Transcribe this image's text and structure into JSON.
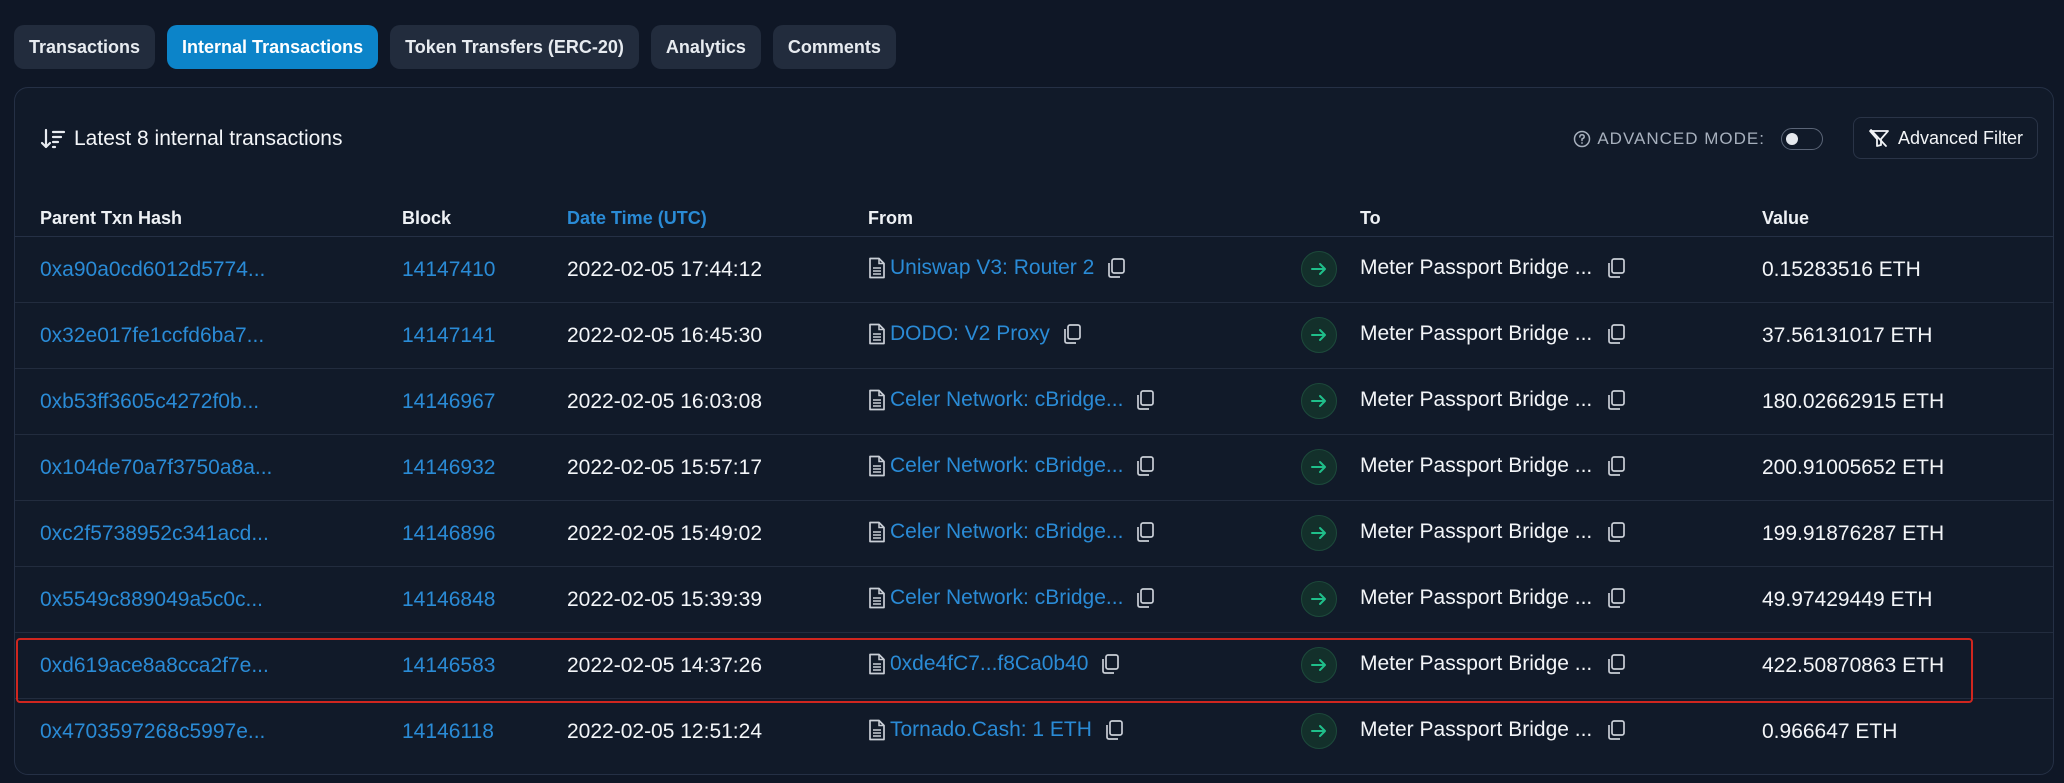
{
  "tabs": [
    {
      "label": "Transactions"
    },
    {
      "label": "Internal Transactions"
    },
    {
      "label": "Token Transfers (ERC-20)"
    },
    {
      "label": "Analytics"
    },
    {
      "label": "Comments"
    }
  ],
  "active_tab": "Internal Transactions",
  "card": {
    "summary": "Latest 8 internal transactions",
    "advanced_mode_label": "ADVANCED MODE:",
    "advanced_mode_on": false,
    "advanced_filter_label": "Advanced Filter"
  },
  "table": {
    "headers": {
      "parent_hash": "Parent Txn Hash",
      "block": "Block",
      "datetime": "Date Time (UTC)",
      "from": "From",
      "to": "To",
      "value": "Value"
    },
    "rows": [
      {
        "hash": "0xa90a0cd6012d5774...",
        "block": "14147410",
        "datetime": "2022-02-05 17:44:12",
        "from": "Uniswap V3: Router 2",
        "to": "Meter Passport Bridge ...",
        "value": "0.15283516 ETH"
      },
      {
        "hash": "0x32e017fe1ccfd6ba7...",
        "block": "14147141",
        "datetime": "2022-02-05 16:45:30",
        "from": "DODO: V2 Proxy",
        "to": "Meter Passport Bridge ...",
        "value": "37.56131017 ETH"
      },
      {
        "hash": "0xb53ff3605c4272f0b...",
        "block": "14146967",
        "datetime": "2022-02-05 16:03:08",
        "from": "Celer Network: cBridge...",
        "to": "Meter Passport Bridge ...",
        "value": "180.02662915 ETH"
      },
      {
        "hash": "0x104de70a7f3750a8a...",
        "block": "14146932",
        "datetime": "2022-02-05 15:57:17",
        "from": "Celer Network: cBridge...",
        "to": "Meter Passport Bridge ...",
        "value": "200.91005652 ETH"
      },
      {
        "hash": "0xc2f5738952c341acd...",
        "block": "14146896",
        "datetime": "2022-02-05 15:49:02",
        "from": "Celer Network: cBridge...",
        "to": "Meter Passport Bridge ...",
        "value": "199.91876287 ETH"
      },
      {
        "hash": "0x5549c889049a5c0c...",
        "block": "14146848",
        "datetime": "2022-02-05 15:39:39",
        "from": "Celer Network: cBridge...",
        "to": "Meter Passport Bridge ...",
        "value": "49.97429449 ETH"
      },
      {
        "hash": "0xd619ace8a8cca2f7e...",
        "block": "14146583",
        "datetime": "2022-02-05 14:37:26",
        "from": "0xde4fC7...f8Ca0b40",
        "to": "Meter Passport Bridge ...",
        "value": "422.50870863 ETH"
      },
      {
        "hash": "0x4703597268c5997e...",
        "block": "14146118",
        "datetime": "2022-02-05 12:51:24",
        "from": "Tornado.Cash: 1 ETH",
        "to": "Meter Passport Bridge ...",
        "value": "0.966647 ETH"
      }
    ]
  },
  "highlighted_row": 6,
  "icons": {
    "sort": "sort-descending-icon",
    "help": "question-circle-icon",
    "filter": "filter-icon",
    "contract": "document-icon",
    "copy": "copy-icon",
    "direction": "arrow-right-icon"
  },
  "colors": {
    "background": "#0f1726",
    "accent": "#0c84c9",
    "link": "#2a8bd6",
    "arrow": "#1fbf8a",
    "highlight": "#d0261f"
  }
}
